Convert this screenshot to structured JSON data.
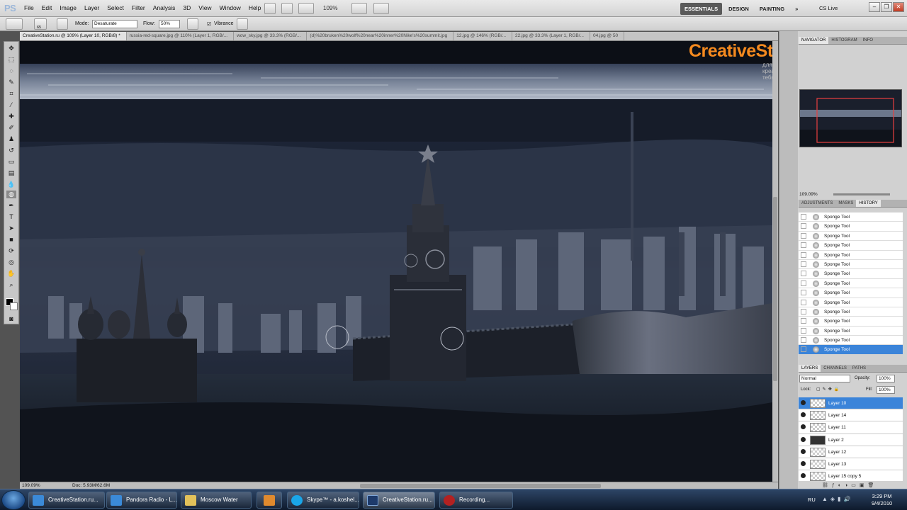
{
  "app": {
    "logo": "PS",
    "menus": [
      "File",
      "Edit",
      "Image",
      "Layer",
      "Select",
      "Filter",
      "Analysis",
      "3D",
      "View",
      "Window",
      "Help"
    ],
    "zoom": "109%",
    "workspaces": [
      "ESSENTIALS",
      "DESIGN",
      "PAINTING"
    ],
    "active_workspace": "ESSENTIALS",
    "overflow": "»",
    "cs_live": "CS Live"
  },
  "options": {
    "brush_size": "65",
    "mode_label": "Mode:",
    "mode_value": "Desaturate",
    "flow_label": "Flow:",
    "flow_value": "50%",
    "vibrance_label": "Vibrance"
  },
  "doc_tabs": [
    "CreativeStation.ru @ 109% (Layer 10, RGB/8) *",
    "russia-red-square.jpg @ 110% (Layer 1, RGB/...",
    "wow_sky.jpg @ 33.3% (RGB/...",
    "(d)%20bruken%20wolf%20near%20inner%20Nike's%20summit.jpg",
    "12.jpg @ 146% (RGB/...",
    "22.jpg @ 33.3% (Layer 1, RGB/...",
    "04.jpg @ 50"
  ],
  "status": {
    "zoom": "109.09%",
    "doc": "Doc: 5.93M/62.6M"
  },
  "watermark": {
    "brand": "CreativeStation",
    "tagline": "для креативного тебя"
  },
  "navigator": {
    "tabs": [
      "NAVIGATOR",
      "HISTOGRAM",
      "INFO"
    ],
    "zoom": "109.09%"
  },
  "history": {
    "tabs": [
      "ADJUSTMENTS",
      "MASKS",
      "HISTORY"
    ],
    "items": [
      "Sponge Tool",
      "Sponge Tool",
      "Sponge Tool",
      "Sponge Tool",
      "Sponge Tool",
      "Sponge Tool",
      "Sponge Tool",
      "Sponge Tool",
      "Sponge Tool",
      "Sponge Tool",
      "Sponge Tool",
      "Sponge Tool",
      "Sponge Tool",
      "Sponge Tool",
      "Sponge Tool"
    ]
  },
  "layers": {
    "tabs": [
      "LAYERS",
      "CHANNELS",
      "PATHS"
    ],
    "blend": "Normal",
    "opacity_label": "Opacity:",
    "opacity": "100%",
    "lock_label": "Lock:",
    "fill_label": "Fill:",
    "fill": "100%",
    "items": [
      "Layer 10",
      "Layer 14",
      "Layer 11",
      "Layer 2",
      "Layer 12",
      "Layer 13",
      "Layer 15 copy 5"
    ]
  },
  "taskbar": {
    "items": [
      "CreativeStation.ru...",
      "Pandora Radio - L...",
      "Moscow Water",
      "",
      "Skype™ - a.koshel...",
      "CreativeStation.ru...",
      "Recording..."
    ],
    "lang": "RU",
    "time": "3:29 PM",
    "date": "9/4/2010"
  }
}
